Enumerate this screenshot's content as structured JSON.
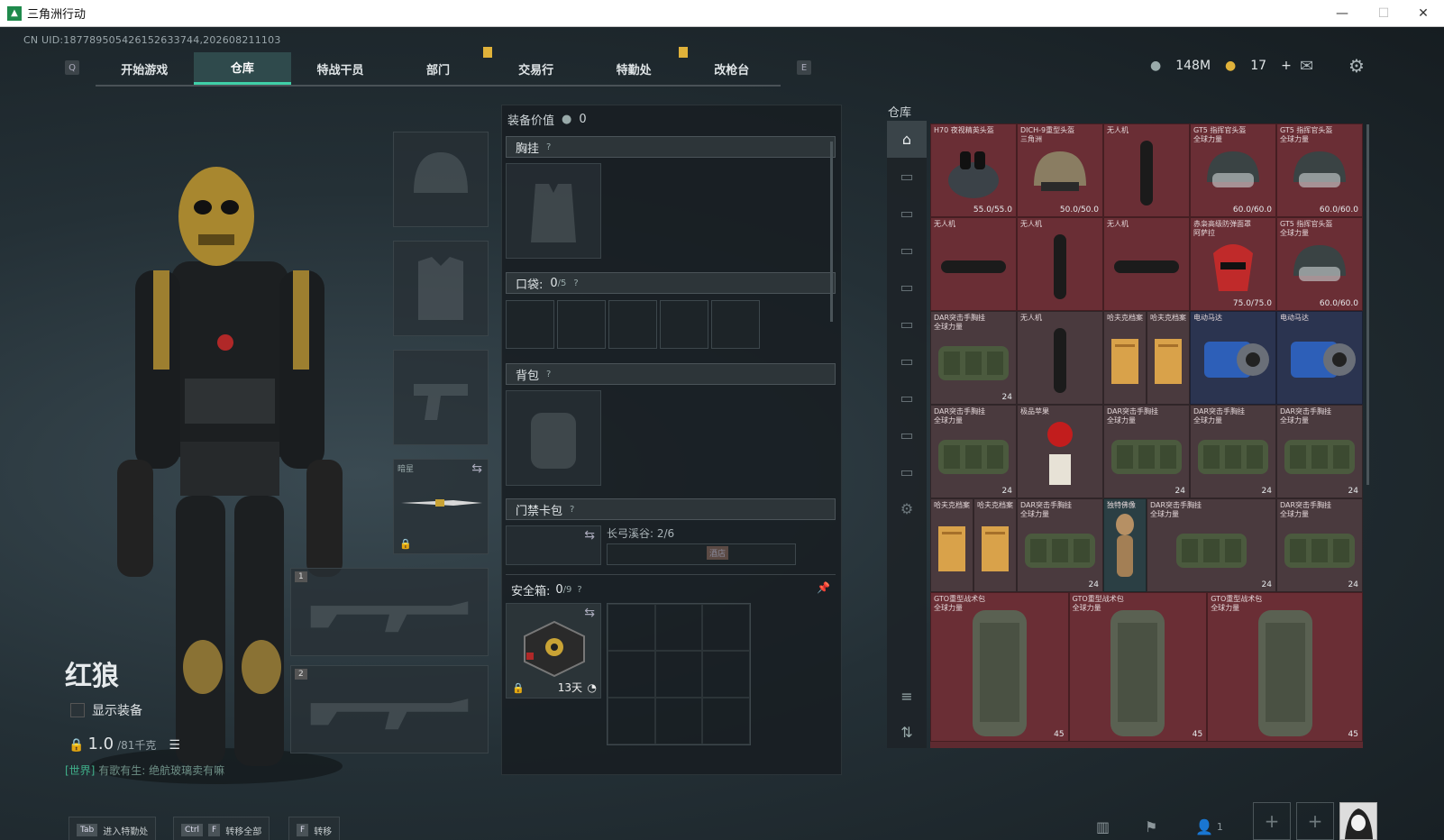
{
  "window": {
    "title": "三角洲行动",
    "minimize": "—",
    "maximize": "☐",
    "close": "✕"
  },
  "uid": "CN UID:18778950542615263374​4,202608211103",
  "nav": {
    "left_key": "Q",
    "right_key": "E",
    "tabs": [
      "开始游戏",
      "仓库",
      "特战干员",
      "部门",
      "交易行",
      "特勤处",
      "改枪台"
    ],
    "active": "仓库"
  },
  "currency": {
    "coins": "148M",
    "tickets": "17",
    "add": "+"
  },
  "character": {
    "name": "红狼",
    "show_equipment": "显示装备",
    "weight_value": "1.0",
    "weight_max": "/81千克",
    "chat_channel": "[世界]",
    "chat_user": "有歌有生:",
    "chat_text": "绝航玻璃卖有嘛"
  },
  "slots": {
    "melee_label": "暗星",
    "primary_index": "1",
    "secondary_index": "2"
  },
  "equipment": {
    "header_label": "装备价值",
    "header_value": "0",
    "chest_rig": "胸挂",
    "pocket_label": "口袋:",
    "pocket_count": "0",
    "pocket_max": "/5",
    "backpack": "背包",
    "keycard": "门禁卡包",
    "keycard_map": "长弓溪谷: 2/6",
    "keycard_item": "酒店",
    "safebox_label": "安全箱:",
    "safebox_count": "0",
    "safebox_max": "/9",
    "safebox_timer": "13天",
    "help": "?"
  },
  "warehouse": {
    "title": "仓库",
    "items": [
      {
        "name": "H70 夜视精英头盔",
        "dur": "55.0/55.0"
      },
      {
        "name": "DICH-9重型头盔\n三角洲",
        "dur": "50.0/50.0"
      },
      {
        "name": "无人机",
        "dur": ""
      },
      {
        "name": "GT5 指挥官头盔\n全球力量",
        "dur": "60.0/60.0"
      },
      {
        "name": "GT5 指挥官头盔\n全球力量",
        "dur": "60.0/60.0"
      },
      {
        "name": "无人机",
        "dur": ""
      },
      {
        "name": "无人机",
        "dur": ""
      },
      {
        "name": "无人机",
        "dur": ""
      },
      {
        "name": "赤枭高级防弹面罩\n阿萨拉",
        "dur": "75.0/75.0"
      },
      {
        "name": "GT5 指挥官头盔\n全球力量",
        "dur": "60.0/60.0"
      },
      {
        "name": "DAR突击手胸挂\n全球力量",
        "dur": "24"
      },
      {
        "name": "无人机",
        "dur": ""
      },
      {
        "name": "哈夫克档案",
        "dur": ""
      },
      {
        "name": "哈夫克档案",
        "dur": ""
      },
      {
        "name": "电动马达",
        "dur": ""
      },
      {
        "name": "电动马达",
        "dur": ""
      },
      {
        "name": "DAR突击手胸挂\n全球力量",
        "dur": "24"
      },
      {
        "name": "极品苹果",
        "dur": ""
      },
      {
        "name": "DAR突击手胸挂\n全球力量",
        "dur": "24"
      },
      {
        "name": "DAR突击手胸挂\n全球力量",
        "dur": "24"
      },
      {
        "name": "DAR突击手胸挂\n全球力量",
        "dur": "24"
      },
      {
        "name": "哈夫克档案",
        "dur": ""
      },
      {
        "name": "哈夫克档案",
        "dur": ""
      },
      {
        "name": "DAR突击手胸挂\n全球力量",
        "dur": "24"
      },
      {
        "name": "独特佛像",
        "dur": ""
      },
      {
        "name": "DAR突击手胸挂\n全球力量",
        "dur": "24"
      },
      {
        "name": "DAR突击手胸挂\n全球力量",
        "dur": "24"
      },
      {
        "name": "GTO重型战术包\n全球力量",
        "dur": "45"
      },
      {
        "name": "GTO重型战术包\n全球力量",
        "dur": "45"
      },
      {
        "name": "GTO重型战术包\n全球力量",
        "dur": "45"
      }
    ]
  },
  "bottom": {
    "hint1_key": "Tab",
    "hint1": "进入特勤处",
    "hint2_key1": "Ctrl",
    "hint2_key2": "F",
    "hint2": "转移全部",
    "hint3_key": "F",
    "hint3": "转移",
    "squad_count": "1"
  },
  "colors": {
    "accent": "#3fd0a8",
    "tab_active": "#2f4a4c",
    "warehouse_bg": "#5e2a30",
    "gold": "#e0b23a"
  }
}
